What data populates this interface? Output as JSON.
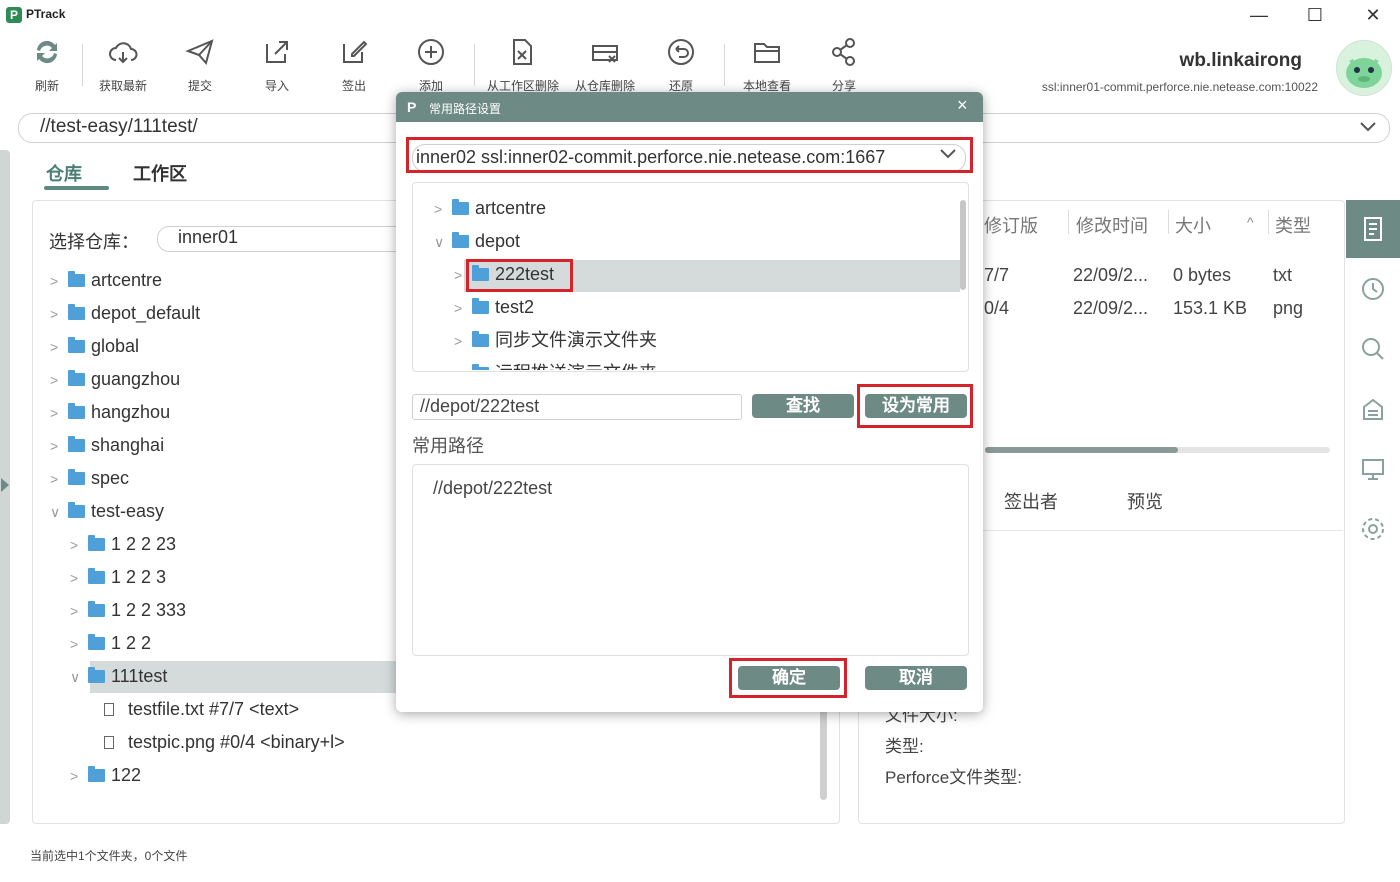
{
  "app": {
    "title": "PTrack",
    "logo": "P"
  },
  "window_controls": {
    "minimize": "—",
    "maximize": "☐",
    "close": "✕"
  },
  "toolbar": {
    "items": [
      {
        "label": "刷新",
        "icon": "refresh-icon"
      },
      {
        "label": "获取最新",
        "icon": "cloud-download-icon"
      },
      {
        "label": "提交",
        "icon": "send-icon"
      },
      {
        "label": "导入",
        "icon": "import-icon"
      },
      {
        "label": "签出",
        "icon": "edit-icon"
      },
      {
        "label": "添加",
        "icon": "plus-circle-icon"
      },
      {
        "label": "从工作区删除",
        "icon": "file-delete-icon"
      },
      {
        "label": "从仓库删除",
        "icon": "repo-delete-icon"
      },
      {
        "label": "还原",
        "icon": "undo-icon"
      },
      {
        "label": "本地查看",
        "icon": "folder-open-icon"
      },
      {
        "label": "分享",
        "icon": "share-icon"
      }
    ]
  },
  "user": {
    "name": "wb.linkairong",
    "server": "ssl:inner01-commit.perforce.nie.netease.com:10022"
  },
  "pathbar": {
    "path": "//test-easy/111test/"
  },
  "tabs": {
    "repo": "仓库",
    "workspace": "工作区"
  },
  "left_panel": {
    "repo_label": "选择仓库：",
    "repo_value": "inner01",
    "tree": [
      {
        "label": "artcentre",
        "caret": ">",
        "type": "folder",
        "depth": 0
      },
      {
        "label": "depot_default",
        "caret": ">",
        "type": "folder",
        "depth": 0
      },
      {
        "label": "global",
        "caret": ">",
        "type": "folder",
        "depth": 0
      },
      {
        "label": "guangzhou",
        "caret": ">",
        "type": "folder",
        "depth": 0
      },
      {
        "label": "hangzhou",
        "caret": ">",
        "type": "folder",
        "depth": 0
      },
      {
        "label": "shanghai",
        "caret": ">",
        "type": "folder",
        "depth": 0
      },
      {
        "label": "spec",
        "caret": ">",
        "type": "folder",
        "depth": 0
      },
      {
        "label": "test-easy",
        "caret": "∨",
        "type": "folder",
        "depth": 0
      },
      {
        "label": "1 2 2 23",
        "caret": ">",
        "type": "folder",
        "depth": 1
      },
      {
        "label": "1 2 2 3",
        "caret": ">",
        "type": "folder",
        "depth": 1
      },
      {
        "label": "1 2 2 333",
        "caret": ">",
        "type": "folder",
        "depth": 1
      },
      {
        "label": "1 2 2",
        "caret": ">",
        "type": "folder",
        "depth": 1
      },
      {
        "label": "111test",
        "caret": "∨",
        "type": "folder",
        "depth": 1
      },
      {
        "label": "testfile.txt  #7/7 <text>",
        "caret": "",
        "type": "file",
        "depth": 2
      },
      {
        "label": "testpic.png  #0/4 <binary+l>",
        "caret": "",
        "type": "file",
        "depth": 2
      },
      {
        "label": "122",
        "caret": ">",
        "type": "folder",
        "depth": 1
      }
    ]
  },
  "right_panel": {
    "headers": {
      "revision": "修订版",
      "modified": "修改时间",
      "size": "大小",
      "type": "类型"
    },
    "rows": [
      {
        "revision": "7/7",
        "modified": "22/09/2...",
        "size": "0 bytes",
        "type": "txt"
      },
      {
        "revision": "0/4",
        "modified": "22/09/2...",
        "size": "153.1 KB",
        "type": "png"
      }
    ],
    "progress": 0.56,
    "detail_tabs": {
      "checkout_by": "签出者",
      "preview": "预览"
    },
    "props": {
      "file_size": "文件大小:",
      "type": "类型:",
      "perforce_type": "Perforce文件类型:"
    }
  },
  "status": "当前选中1个文件夹，0个文件",
  "dialog": {
    "title": "常用路径设置",
    "close": "×",
    "server_select": "inner02  ssl:inner02-commit.perforce.nie.netease.com:1667",
    "tree": [
      {
        "label": "artcentre",
        "caret": ">",
        "depth": 0
      },
      {
        "label": "depot",
        "caret": "∨",
        "depth": 0
      },
      {
        "label": "222test",
        "caret": ">",
        "depth": 1
      },
      {
        "label": "test2",
        "caret": ">",
        "depth": 1
      },
      {
        "label": "同步文件演示文件夹",
        "caret": ">",
        "depth": 1
      },
      {
        "label": "远程推送演示文件夹",
        "caret": ">",
        "depth": 1
      }
    ],
    "path_input": "//depot/222test",
    "find": "查找",
    "set_common": "设为常用",
    "common_label": "常用路径",
    "common_items": [
      "//depot/222test"
    ],
    "ok": "确定",
    "cancel": "取消"
  }
}
